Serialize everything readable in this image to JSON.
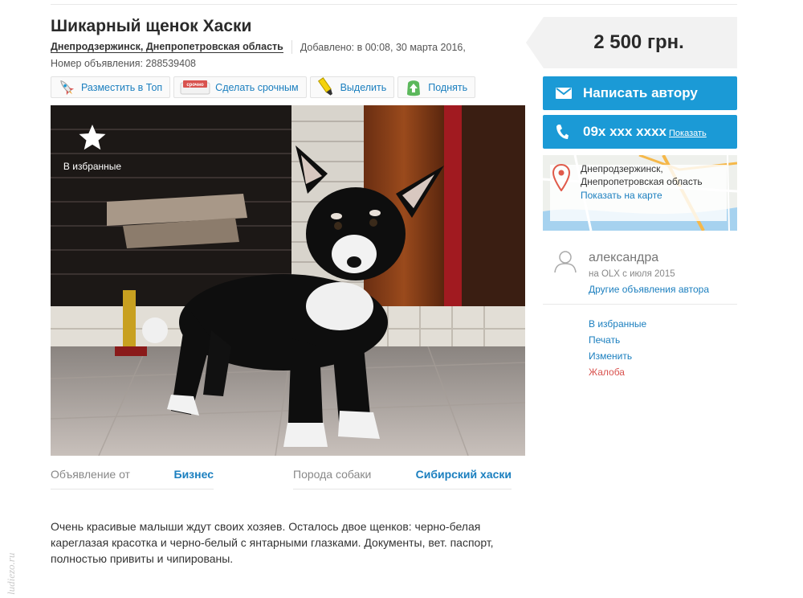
{
  "listing": {
    "title": "Шикарный щенок Хаски",
    "city": "Днепродзержинск, Днепропетровская область",
    "added": "Добавлено: в 00:08, 30 марта 2016,",
    "ad_number": "Номер объявления: 288539408"
  },
  "actions": [
    {
      "label": "Разместить в Топ",
      "icon": "rocket-icon"
    },
    {
      "label": "Сделать срочным",
      "icon": "urgent-badge-icon",
      "badge": "срочно"
    },
    {
      "label": "Выделить",
      "icon": "highlighter-icon"
    },
    {
      "label": "Поднять",
      "icon": "arrow-up-icon"
    }
  ],
  "photo": {
    "favorites_label": "В избранные"
  },
  "params": [
    {
      "label": "Объявление от",
      "value": "Бизнес"
    },
    {
      "label": "Порода собаки",
      "value": "Сибирский хаски"
    }
  ],
  "description": "Очень красивые малыши ждут своих хозяев. Осталось двое щенков: черно-белая кареглазая красотка и черно-белый с янтарными глазками. Документы, вет. паспорт, полностью привиты и чипированы.",
  "price": "2 500 грн.",
  "contact": {
    "write_label": "Написать автору",
    "phone": "09x xxx xxxx",
    "show_label": "Показать"
  },
  "map": {
    "address_line1": "Днепродзержинск,",
    "address_line2": "Днепропетровская область",
    "show_on_map": "Показать на карте"
  },
  "seller": {
    "name": "александра",
    "since": "на OLX с июля 2015",
    "other_ads": "Другие объявления автора"
  },
  "side_links": {
    "favorites": "В избранные",
    "print": "Печать",
    "edit": "Изменить",
    "complain": "Жалоба"
  },
  "watermark": "ludiezo.ru",
  "colors": {
    "accent_blue": "#1b9ad6",
    "link_blue": "#1b7fbf",
    "complain_red": "#d9534f"
  }
}
